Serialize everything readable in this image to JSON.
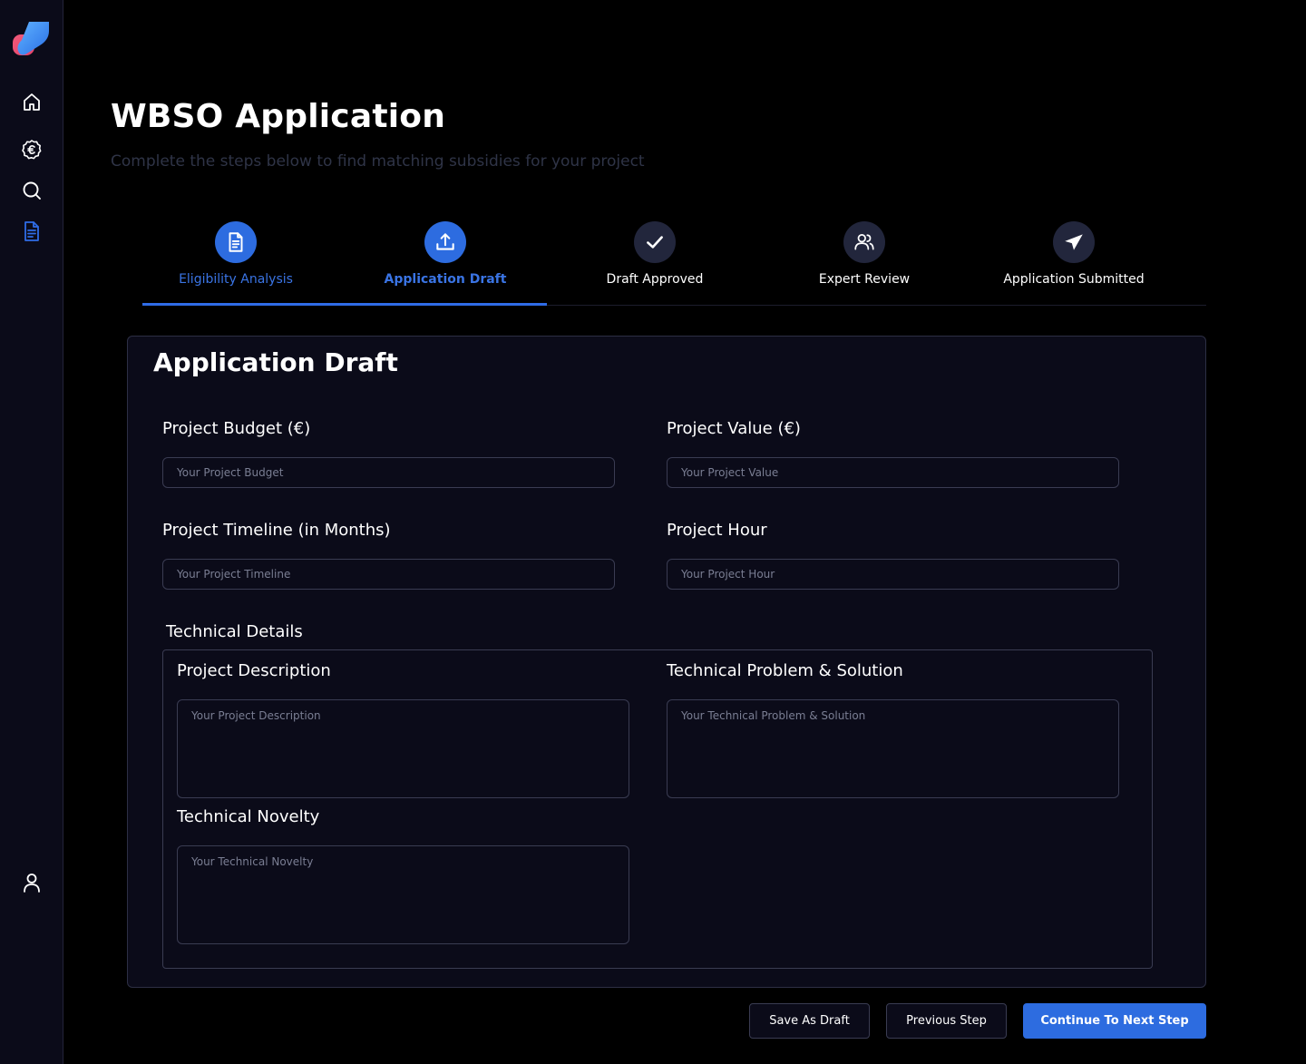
{
  "sidebar": {
    "logo": "app-logo",
    "items": [
      {
        "icon": "home-icon"
      },
      {
        "icon": "euro-coin-icon"
      },
      {
        "icon": "search-icon"
      },
      {
        "icon": "document-icon",
        "active": true
      }
    ],
    "bottom_icon": "user-icon"
  },
  "header": {
    "title": "WBSO Application",
    "subtitle": "Complete the steps below to find matching subsidies for your project"
  },
  "stepper": {
    "progress_percent": 38,
    "steps": [
      {
        "label": "Eligibility Analysis",
        "icon": "document-icon",
        "state": "done"
      },
      {
        "label": "Application Draft",
        "icon": "upload-icon",
        "state": "current"
      },
      {
        "label": "Draft Approved",
        "icon": "check-icon",
        "state": "pending"
      },
      {
        "label": "Expert Review",
        "icon": "users-icon",
        "state": "pending"
      },
      {
        "label": "Application Submitted",
        "icon": "send-icon",
        "state": "pending"
      }
    ]
  },
  "form": {
    "title": "Application Draft",
    "budget": {
      "label": "Project Budget (€)",
      "placeholder": "Your Project Budget",
      "value": ""
    },
    "value": {
      "label": "Project Value (€)",
      "placeholder": "Your Project Value",
      "value": ""
    },
    "timeline": {
      "label": "Project Timeline (in Months)",
      "placeholder": "Your Project Timeline",
      "value": ""
    },
    "hour": {
      "label": "Project Hour",
      "placeholder": "Your Project Hour",
      "value": ""
    },
    "technical": {
      "label": "Technical Details",
      "description": {
        "label": "Project Description",
        "placeholder": "Your Project Description"
      },
      "problem": {
        "label": "Technical Problem & Solution",
        "placeholder": "Your Technical Problem & Solution"
      },
      "novelty": {
        "label": "Technical Novelty",
        "placeholder": "Your Technical Novelty"
      }
    }
  },
  "actions": {
    "save_draft": "Save As Draft",
    "previous": "Previous Step",
    "continue": "Continue To Next Step"
  },
  "colors": {
    "accent": "#2d6ce0",
    "background": "#000000",
    "panel": "#0b0b19",
    "border": "#3a3c52"
  }
}
